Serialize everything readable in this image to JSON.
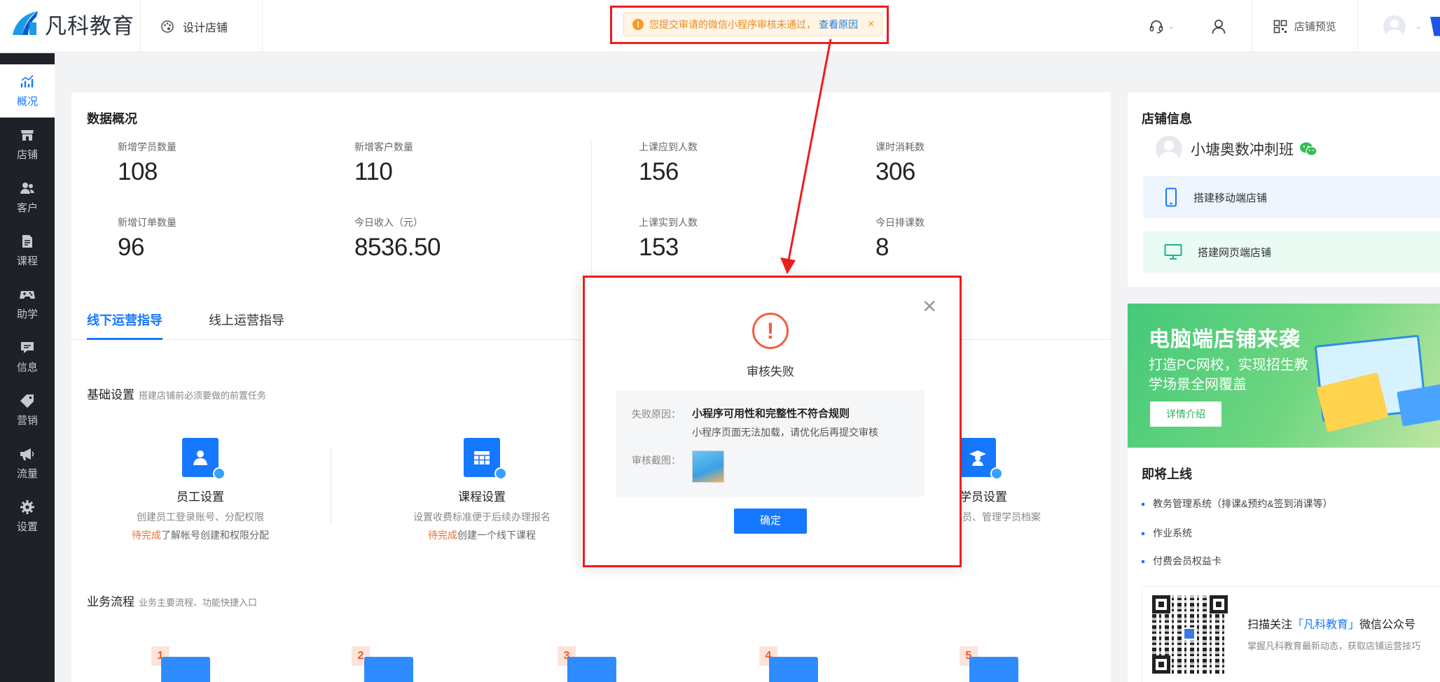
{
  "header": {
    "brand": "凡科教育",
    "design_shop": "设计店铺",
    "notice_text": "您提交审请的微信小程序审核未通过，",
    "notice_link": "查看原因",
    "notice_close": "×",
    "preview": "店铺预览"
  },
  "sidebar": {
    "items": [
      {
        "label": "概况",
        "icon": "chart-icon"
      },
      {
        "label": "店铺",
        "icon": "shop-icon"
      },
      {
        "label": "客户",
        "icon": "users-icon"
      },
      {
        "label": "课程",
        "icon": "document-icon"
      },
      {
        "label": "助学",
        "icon": "gamepad-icon"
      },
      {
        "label": "信息",
        "icon": "message-icon"
      },
      {
        "label": "营销",
        "icon": "tag-icon"
      },
      {
        "label": "流量",
        "icon": "megaphone-icon"
      },
      {
        "label": "设置",
        "icon": "gear-icon"
      }
    ]
  },
  "overview": {
    "title": "数据概况",
    "stats": [
      {
        "label": "新增学员数量",
        "value": "108"
      },
      {
        "label": "新增客户数量",
        "value": "110"
      },
      {
        "label": "上课应到人数",
        "value": "156"
      },
      {
        "label": "课时消耗数",
        "value": "306"
      },
      {
        "label": "新增订单数量",
        "value": "96"
      },
      {
        "label": "今日收入（元）",
        "value": "8536.50"
      },
      {
        "label": "上课实到人数",
        "value": "153"
      },
      {
        "label": "今日排课数",
        "value": "8"
      }
    ]
  },
  "tabs": [
    {
      "label": "线下运营指导",
      "active": true
    },
    {
      "label": "线上运营指导",
      "active": false
    }
  ],
  "basic_setup": {
    "title": "基础设置",
    "hint": "搭建店铺前必须要做的前置任务",
    "cards": [
      {
        "title": "员工设置",
        "desc": "创建员工登录账号、分配权限",
        "pending": "待完成",
        "status": "了解帐号创建和权限分配"
      },
      {
        "title": "课程设置",
        "desc": "设置收费标准便于后续办理报名",
        "pending": "待完成",
        "status": "创建一个线下课程"
      },
      {
        "title": "学员设置",
        "desc": "学员、管理学员档案",
        "pending": "",
        "status": ""
      }
    ]
  },
  "business_flow": {
    "title": "业务流程",
    "hint": "业务主要流程、功能快捷入口",
    "steps": [
      "1",
      "2",
      "3",
      "4",
      "5"
    ]
  },
  "shop_info": {
    "title": "店铺信息",
    "name": "小塘奥数冲刺班",
    "mobile": "搭建移动端店铺",
    "web": "搭建网页端店铺"
  },
  "banner": {
    "title": "电脑端店铺来袭",
    "subtitle": "打造PC网校，实现招生教学场景全网覆盖",
    "button": "详情介绍"
  },
  "coming_soon": {
    "title": "即将上线",
    "items": [
      "教务管理系统（排课&预约&签到消课等）",
      "作业系统",
      "付费会员权益卡"
    ],
    "qr_text_pre": "扫描关注",
    "qr_text_hl": "「凡科教育」",
    "qr_text_post": "微信公众号",
    "qr_sub": "掌握凡科教育最新动态，获取店铺运营技巧"
  },
  "modal": {
    "title": "审核失败",
    "reason_label": "失败原因：",
    "reason_main": "小程序可用性和完整性不符合规则",
    "reason_sub": "小程序页面无法加载，请优化后再提交审核",
    "shot_label": "审核截图：",
    "ok": "确定"
  },
  "colors": {
    "accent": "#1677ff",
    "warning": "#f59a23",
    "error": "#f25f3a",
    "highlight_box": "#ef1c1c",
    "sidebar_bg": "#1e2227"
  }
}
